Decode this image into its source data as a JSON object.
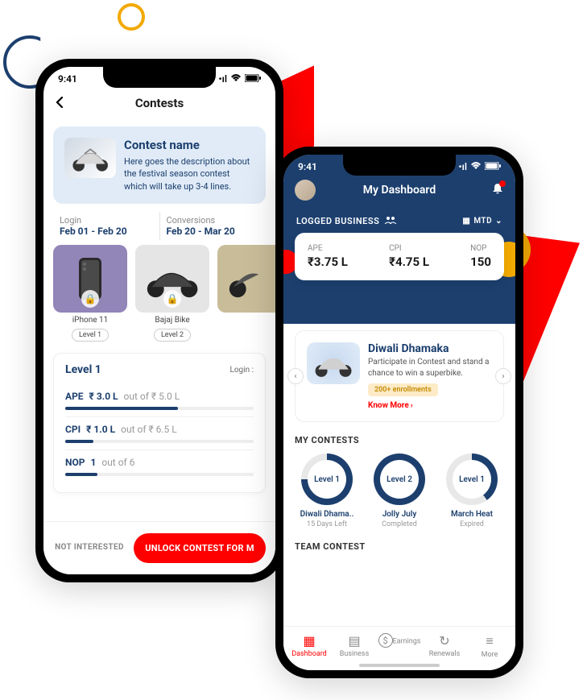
{
  "status_time": "9:41",
  "phone1": {
    "title": "Contests",
    "contest": {
      "name": "Contest name",
      "desc": "Here goes the description about the festival season contest which will take up 3-4 lines."
    },
    "dates": {
      "login_lbl": "Login",
      "login_val": "Feb 01 - Feb 20",
      "conv_lbl": "Conversions",
      "conv_val": "Feb 20 - Mar 20"
    },
    "prizes": [
      {
        "label": "iPhone 11",
        "level": "Level 1"
      },
      {
        "label": "Bajaj Bike",
        "level": "Level 2"
      },
      {
        "label": "",
        "level": ""
      }
    ],
    "level": {
      "title": "Level 1",
      "right": "Login :",
      "metrics": [
        {
          "name": "APE",
          "value": "₹ 3.0 L",
          "rest": "out of ₹ 5.0 L",
          "pct": 60
        },
        {
          "name": "CPI",
          "value": "₹ 1.0 L",
          "rest": "out of ₹ 6.5 L",
          "pct": 15
        },
        {
          "name": "NOP",
          "value": "1",
          "rest": "out of 6",
          "pct": 17
        }
      ]
    },
    "footer": {
      "not_interested": "NOT INTERESTED",
      "unlock": "UNLOCK CONTEST FOR M"
    }
  },
  "phone2": {
    "title": "My Dashboard",
    "section_label": "LOGGED BUSINESS",
    "period": "MTD",
    "stats": [
      {
        "lbl": "APE",
        "val": "₹3.75 L"
      },
      {
        "lbl": "CPI",
        "val": "₹4.75 L"
      },
      {
        "lbl": "NOP",
        "val": "150"
      }
    ],
    "diwali": {
      "title": "Diwali Dhamaka",
      "desc": "Participate in Contest and stand a chance to win a superbike.",
      "enroll": "200+ enrollments",
      "more": "Know More"
    },
    "my_contests_label": "MY CONTESTS",
    "contests": [
      {
        "level": "Level 1",
        "name": "Diwali Dhama..",
        "status": "15 Days Left",
        "progress": 75
      },
      {
        "level": "Level 2",
        "name": "Jolly July",
        "status": "Completed",
        "progress": 100
      },
      {
        "level": "Level 1",
        "name": "March Heat",
        "status": "Expired",
        "progress": 40
      }
    ],
    "team_label": "TEAM CONTEST",
    "tabs": [
      {
        "label": "Dashboard",
        "icon": "▦"
      },
      {
        "label": "Business",
        "icon": "▤"
      },
      {
        "label": "Earnings",
        "icon": "$"
      },
      {
        "label": "Renewals",
        "icon": "↻"
      },
      {
        "label": "More",
        "icon": "≡"
      }
    ]
  }
}
